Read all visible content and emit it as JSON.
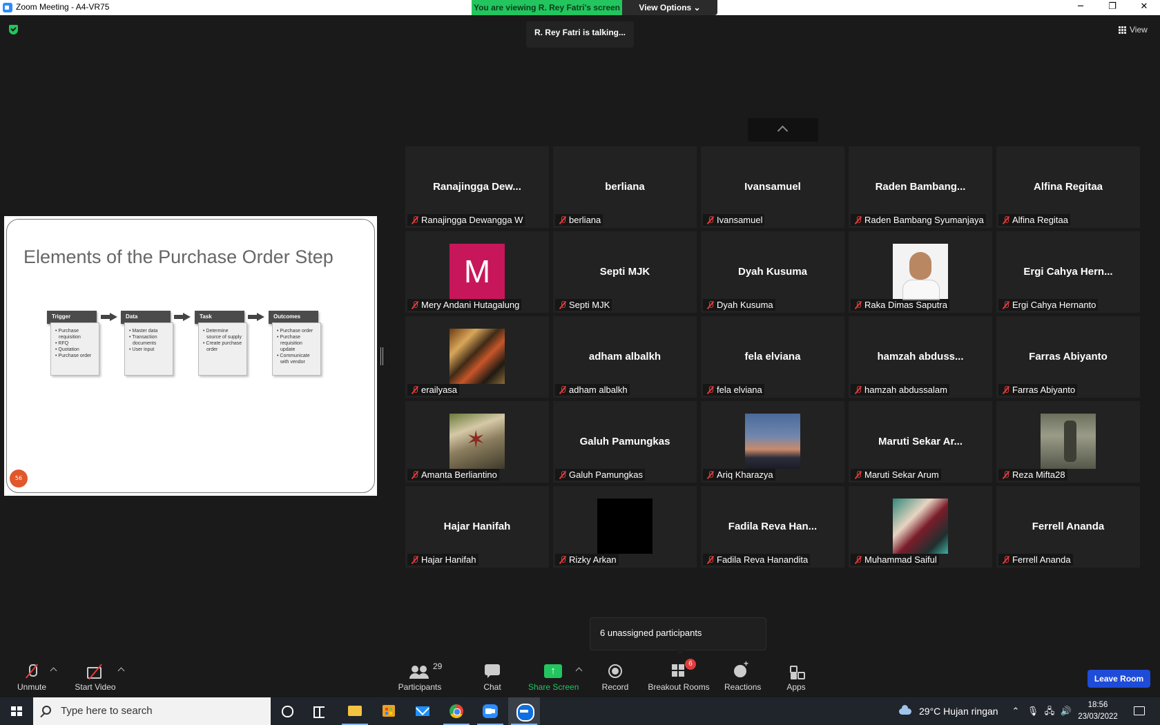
{
  "window": {
    "title": "Zoom Meeting - A4-VR75",
    "min": "─",
    "restore": "❐",
    "close": "✕"
  },
  "banner": {
    "viewing": "You are viewing R. Rey Fatri's screen",
    "view_options": "View Options ⌄",
    "talking": "R. Rey Fatri is talking..."
  },
  "view_button": "View",
  "slide": {
    "title": "Elements of the Purchase Order Step",
    "stages": [
      {
        "head": "Trigger",
        "items": [
          "Purchase requisition",
          "RFQ",
          "Quotation",
          "Purchase order"
        ]
      },
      {
        "head": "Data",
        "items": [
          "Master data",
          "Transaction documents",
          "User input"
        ]
      },
      {
        "head": "Task",
        "items": [
          "Determine source of supply",
          "Create purchase order"
        ]
      },
      {
        "head": "Outcomes",
        "items": [
          "Purchase order",
          "Purchase requisition update",
          "Communicate with vendor"
        ]
      }
    ],
    "page_number": "56"
  },
  "participants": [
    {
      "big": "Ranajingga  Dew...",
      "name": "Ranajingga Dewangga W"
    },
    {
      "big": "berliana",
      "name": "berliana"
    },
    {
      "big": "Ivansamuel",
      "name": "Ivansamuel"
    },
    {
      "big": "Raden  Bambang...",
      "name": "Raden Bambang Syumanjaya"
    },
    {
      "big": "Alfina Regitaa",
      "name": "Alfina Regitaa"
    },
    {
      "pic": "m",
      "letter": "M",
      "name": "Mery Andani Hutagalung"
    },
    {
      "big": "Septi MJK",
      "name": "Septi MJK"
    },
    {
      "big": "Dyah Kusuma",
      "name": "Dyah Kusuma"
    },
    {
      "pic": "face",
      "name": "Raka Dimas Saputra"
    },
    {
      "big": "Ergi  Cahya  Hern...",
      "name": "Ergi Cahya Hernanto"
    },
    {
      "pic": "abstract",
      "name": "erailyasa"
    },
    {
      "big": "adham albalkh",
      "name": "adham albalkh"
    },
    {
      "big": "fela elviana",
      "name": "fela elviana"
    },
    {
      "big": "hamzah  abduss...",
      "name": "hamzah abdussalam"
    },
    {
      "big": "Farras Abiyanto",
      "name": "Farras Abiyanto"
    },
    {
      "pic": "shirt",
      "name": "Amanta Berliantino"
    },
    {
      "big": "Galuh Pamungkas",
      "name": "Galuh Pamungkas"
    },
    {
      "pic": "sky",
      "name": "Ariq Kharazya"
    },
    {
      "big": "Maruti  Sekar  Ar...",
      "name": "Maruti Sekar Arum"
    },
    {
      "pic": "statue",
      "name": "Reza Mifta28"
    },
    {
      "big": "Hajar Hanifah",
      "name": "Hajar Hanifah"
    },
    {
      "pic": "black",
      "name": "Rizky Arkan"
    },
    {
      "big": "Fadila  Reva  Han...",
      "name": "Fadila Reva Hanandita"
    },
    {
      "pic": "anime",
      "name": "Muhammad Saiful"
    },
    {
      "big": "Ferrell Ananda",
      "name": "Ferrell Ananda"
    }
  ],
  "unassigned_popup": "6 unassigned participants",
  "toolbar": {
    "unmute": "Unmute",
    "start_video": "Start Video",
    "participants": "Participants",
    "participants_count": "29",
    "chat": "Chat",
    "share_screen": "Share Screen",
    "record": "Record",
    "breakout_rooms": "Breakout Rooms",
    "breakout_badge": "6",
    "reactions": "Reactions",
    "apps": "Apps",
    "leave": "Leave Room"
  },
  "taskbar": {
    "search_placeholder": "Type here to search",
    "weather": "29°C  Hujan ringan",
    "time": "18:56",
    "date": "23/03/2022"
  },
  "colors": {
    "accent_green": "#23c55e",
    "leave_blue": "#1e4bd8",
    "muted_red": "#e23b3b"
  }
}
